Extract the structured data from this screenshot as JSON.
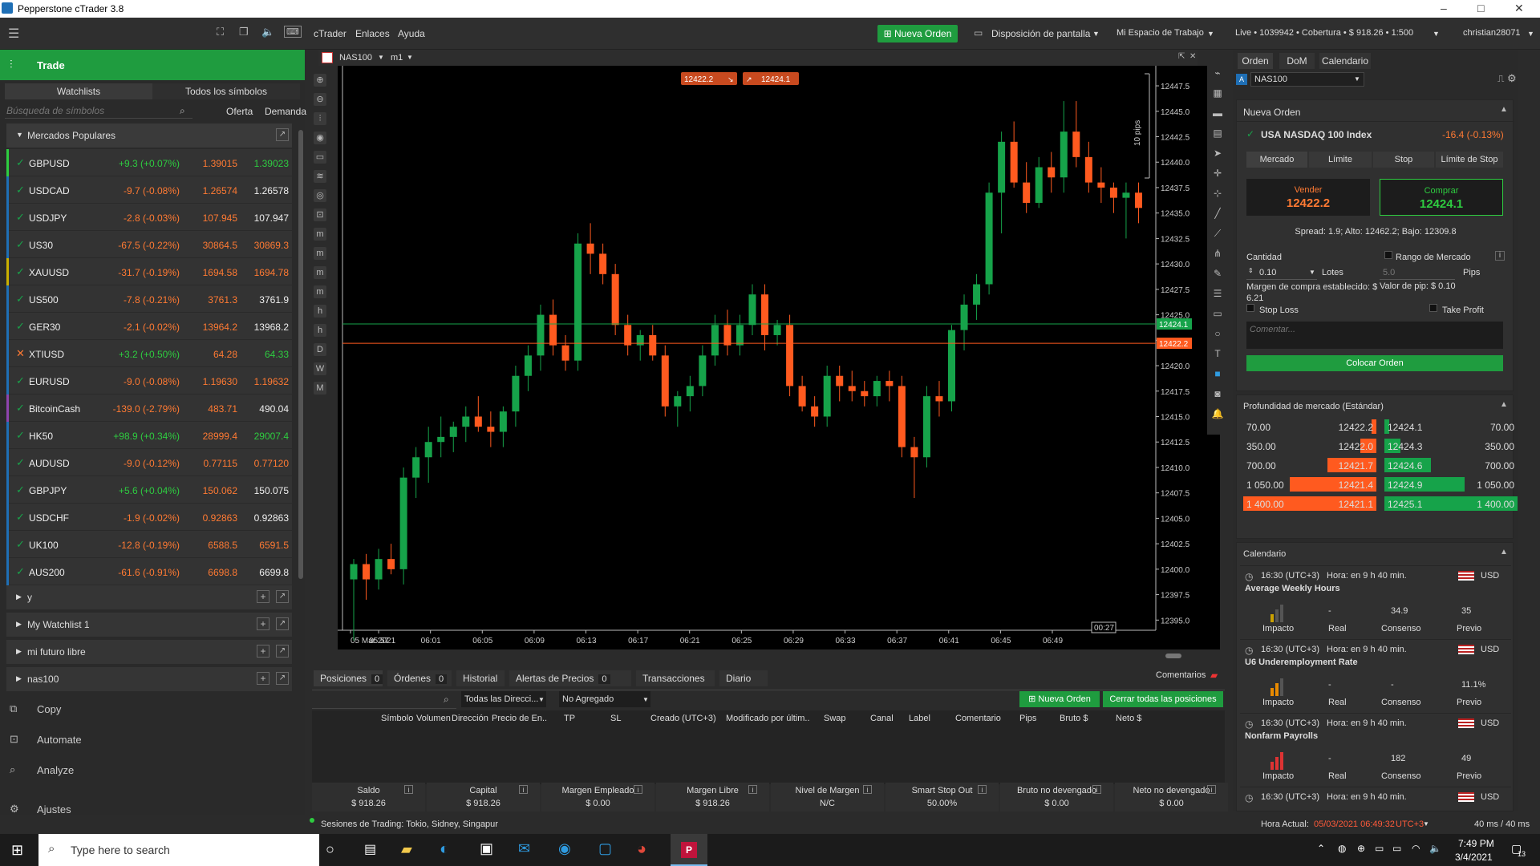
{
  "window": {
    "title": "Pepperstone cTrader 3.8",
    "min": "–",
    "max": "□",
    "close": "✕"
  },
  "menu": {
    "items": [
      "cTrader",
      "Enlaces",
      "Ayuda"
    ],
    "new_order": "Nueva Orden",
    "layout": "Disposición de pantalla",
    "workspace": "Mi Espacio de Trabajo",
    "account": "Live • 1039942 • Cobertura • $ 918.26 • 1:500",
    "user": "christian28071"
  },
  "left": {
    "header": "Trade",
    "tabs": [
      "Watchlists",
      "Todos los símbolos"
    ],
    "search_placeholder": "Búsqueda de símbolos",
    "col_bid": "Oferta",
    "col_ask": "Demanda",
    "group_title": "Mercados Populares",
    "rows": [
      {
        "sym": "GBPUSD",
        "chg": "+9.3 (+0.07%)",
        "bid": "1.39015",
        "ask": "1.39023",
        "up": true,
        "mark": "✓",
        "barcolor": "#2ecc40"
      },
      {
        "sym": "USDCAD",
        "chg": "-9.7 (-0.08%)",
        "bid": "1.26574",
        "ask": "1.26578",
        "up": false,
        "mark": "✓",
        "barcolor": "#1f6fb5"
      },
      {
        "sym": "USDJPY",
        "chg": "-2.8 (-0.03%)",
        "bid": "107.945",
        "ask": "107.947",
        "up": false,
        "mark": "✓",
        "barcolor": "#1f6fb5"
      },
      {
        "sym": "US30",
        "chg": "-67.5 (-0.22%)",
        "bid": "30864.5",
        "ask": "30869.3",
        "up": false,
        "mark": "✓",
        "barcolor": "#1f6fb5"
      },
      {
        "sym": "XAUUSD",
        "chg": "-31.7 (-0.19%)",
        "bid": "1694.58",
        "ask": "1694.78",
        "up": false,
        "mark": "✓",
        "barcolor": "#c9b000"
      },
      {
        "sym": "US500",
        "chg": "-7.8 (-0.21%)",
        "bid": "3761.3",
        "ask": "3761.9",
        "up": false,
        "mark": "✓",
        "barcolor": "#1f6fb5"
      },
      {
        "sym": "GER30",
        "chg": "-2.1 (-0.02%)",
        "bid": "13964.2",
        "ask": "13968.2",
        "up": false,
        "mark": "✓",
        "barcolor": "#1f6fb5"
      },
      {
        "sym": "XTIUSD",
        "chg": "+3.2 (+0.50%)",
        "bid": "64.28",
        "ask": "64.33",
        "up": true,
        "mark": "✕",
        "barcolor": "#1f6fb5"
      },
      {
        "sym": "EURUSD",
        "chg": "-9.0 (-0.08%)",
        "bid": "1.19630",
        "ask": "1.19632",
        "up": false,
        "mark": "✓",
        "barcolor": "#1f6fb5"
      },
      {
        "sym": "BitcoinCash",
        "chg": "-139.0 (-2.79%)",
        "bid": "483.71",
        "ask": "490.04",
        "up": false,
        "mark": "✓",
        "barcolor": "#8e44ad"
      },
      {
        "sym": "HK50",
        "chg": "+98.9 (+0.34%)",
        "bid": "28999.4",
        "ask": "29007.4",
        "up": true,
        "mark": "✓",
        "barcolor": "#1f6fb5"
      },
      {
        "sym": "AUDUSD",
        "chg": "-9.0 (-0.12%)",
        "bid": "0.77115",
        "ask": "0.77120",
        "up": false,
        "mark": "✓",
        "barcolor": "#1f6fb5"
      },
      {
        "sym": "GBPJPY",
        "chg": "+5.6 (+0.04%)",
        "bid": "150.062",
        "ask": "150.075",
        "up": true,
        "mark": "✓",
        "barcolor": "#1f6fb5"
      },
      {
        "sym": "USDCHF",
        "chg": "-1.9 (-0.02%)",
        "bid": "0.92863",
        "ask": "0.92863",
        "up": false,
        "mark": "✓",
        "barcolor": "#1f6fb5"
      },
      {
        "sym": "UK100",
        "chg": "-12.8 (-0.19%)",
        "bid": "6588.5",
        "ask": "6591.5",
        "up": false,
        "mark": "✓",
        "barcolor": "#1f6fb5"
      },
      {
        "sym": "AUS200",
        "chg": "-61.6 (-0.91%)",
        "bid": "6698.8",
        "ask": "6699.8",
        "up": false,
        "mark": "✓",
        "barcolor": "#1f6fb5"
      }
    ],
    "groups": [
      "y",
      "My Watchlist 1",
      "mi futuro libre",
      "nas100"
    ],
    "nav": [
      "Copy",
      "Automate",
      "Analyze",
      "Ajustes"
    ]
  },
  "chart": {
    "symbol": "NAS100",
    "timeframe": "m1",
    "sell_badge": "12422.2",
    "buy_badge": "12424.1",
    "pips_label": "10 pips",
    "price_ticks": [
      "12447.5",
      "12445.0",
      "12442.5",
      "12440.0",
      "12437.5",
      "12435.0",
      "12432.5",
      "12430.0",
      "12427.5",
      "12425.0",
      "12422.5",
      "12420.0",
      "12417.5",
      "12415.0",
      "12412.5",
      "12410.0",
      "12407.5",
      "12405.0",
      "12402.5",
      "12400.0",
      "12397.5",
      "12395.0"
    ],
    "time_ticks": [
      "05 Mar 2021",
      "05:57",
      "06:01",
      "06:05",
      "06:09",
      "06:13",
      "06:17",
      "06:21",
      "06:25",
      "06:29",
      "06:33",
      "06:37",
      "06:41",
      "06:45",
      "06:49"
    ],
    "ask_line": "12424.1",
    "bid_line": "12422.2",
    "countdown": "00:27"
  },
  "chart_data": {
    "type": "candlestick",
    "ylim": [
      12394,
      12449
    ],
    "hlines": [
      12424.1,
      12422.2
    ],
    "candles": [
      [
        12399,
        12401,
        12393,
        12400.5
      ],
      [
        12400.5,
        12401.5,
        12397,
        12399
      ],
      [
        12399,
        12402,
        12398,
        12401
      ],
      [
        12401,
        12402.5,
        12399.5,
        12400
      ],
      [
        12400,
        12410,
        12398.5,
        12409
      ],
      [
        12409,
        12412,
        12407,
        12411
      ],
      [
        12411,
        12414,
        12408.5,
        12412.5
      ],
      [
        12412.5,
        12415,
        12411,
        12413
      ],
      [
        12413,
        12414.5,
        12411.5,
        12414
      ],
      [
        12414,
        12416,
        12412.5,
        12415
      ],
      [
        12415,
        12417,
        12413.5,
        12414
      ],
      [
        12414,
        12415.5,
        12412,
        12413.5
      ],
      [
        12413.5,
        12416,
        12412,
        12415.5
      ],
      [
        12415.5,
        12420,
        12414,
        12419
      ],
      [
        12419,
        12422,
        12417.5,
        12421
      ],
      [
        12421,
        12426,
        12419.5,
        12425
      ],
      [
        12425,
        12426.5,
        12421,
        12422
      ],
      [
        12422,
        12423,
        12419.5,
        12420.5
      ],
      [
        12420.5,
        12433,
        12419.5,
        12432
      ],
      [
        12432,
        12434,
        12429,
        12431
      ],
      [
        12431,
        12432,
        12428,
        12429
      ],
      [
        12429,
        12430,
        12423,
        12424
      ],
      [
        12424,
        12425,
        12421,
        12422
      ],
      [
        12422,
        12423.5,
        12420.5,
        12423
      ],
      [
        12423,
        12424,
        12420.5,
        12421
      ],
      [
        12421,
        12422,
        12415,
        12416
      ],
      [
        12416,
        12417.5,
        12414,
        12417
      ],
      [
        12417,
        12419,
        12415.5,
        12418
      ],
      [
        12418,
        12422,
        12417,
        12421
      ],
      [
        12421,
        12425,
        12420,
        12424
      ],
      [
        12424,
        12425.5,
        12421,
        12422
      ],
      [
        12422,
        12425,
        12421,
        12424
      ],
      [
        12424,
        12428,
        12423,
        12427
      ],
      [
        12427,
        12428,
        12421.5,
        12423
      ],
      [
        12423,
        12424.5,
        12422,
        12424
      ],
      [
        12424,
        12425,
        12417,
        12418
      ],
      [
        12418,
        12419,
        12415.5,
        12416
      ],
      [
        12416,
        12417,
        12414,
        12415
      ],
      [
        12415,
        12420,
        12414,
        12419
      ],
      [
        12419,
        12420,
        12416.5,
        12418
      ],
      [
        12418,
        12419.5,
        12416.5,
        12417.5
      ],
      [
        12417.5,
        12418.5,
        12416,
        12417
      ],
      [
        12417,
        12419,
        12416,
        12418.5
      ],
      [
        12418.5,
        12419.5,
        12416.5,
        12418
      ],
      [
        12418,
        12419,
        12411,
        12412
      ],
      [
        12412,
        12413,
        12407,
        12411
      ],
      [
        12411,
        12418,
        12410,
        12417
      ],
      [
        12417,
        12418.5,
        12415,
        12416.5
      ],
      [
        12416.5,
        12424,
        12415.5,
        12423.5
      ],
      [
        12423.5,
        12427,
        12421.5,
        12426
      ],
      [
        12426,
        12429,
        12424.5,
        12428
      ],
      [
        12428,
        12438,
        12427,
        12437
      ],
      [
        12437,
        12443,
        12433,
        12442
      ],
      [
        12442,
        12444,
        12437.5,
        12438
      ],
      [
        12438,
        12440,
        12435,
        12436
      ],
      [
        12436,
        12440.5,
        12435.5,
        12439.5
      ],
      [
        12439.5,
        12441,
        12437,
        12438.5
      ],
      [
        12438.5,
        12446,
        12437,
        12443
      ],
      [
        12443,
        12446,
        12439.5,
        12440.5
      ],
      [
        12440.5,
        12442,
        12437,
        12438
      ],
      [
        12438,
        12439.5,
        12436,
        12437.5
      ],
      [
        12437.5,
        12438,
        12435,
        12436.5
      ],
      [
        12436.5,
        12438,
        12432.5,
        12437
      ],
      [
        12437,
        12438,
        12434,
        12435.5
      ]
    ]
  },
  "order": {
    "tabs": [
      "Orden",
      "DoM",
      "Calendario"
    ],
    "symbol": "NAS100",
    "title": "Nueva Orden",
    "instrument": "USA NASDAQ 100 Index",
    "change": "-16.4 (-0.13%)",
    "types": [
      "Mercado",
      "Límite",
      "Stop",
      "Límite de Stop"
    ],
    "sell_label": "Vender",
    "sell_price": "12422.2",
    "buy_label": "Comprar",
    "buy_price": "12424.1",
    "spread": "Spread: 1.9; Alto: 12462.2; Bajo: 12309.8",
    "qty_label": "Cantidad",
    "range_label": "Rango de Mercado",
    "qty": "0.10",
    "lots": "Lotes",
    "pips_val": "5.0",
    "pips": "Pips",
    "margin": "Margen de compra establecido: $ 6.21",
    "pip_value": "Valor de pip: $ 0.10",
    "stop_loss": "Stop Loss",
    "take_profit": "Take Profit",
    "comment_placeholder": "Comentar...",
    "place": "Colocar Orden"
  },
  "depth": {
    "title": "Profundidad de mercado (Estándar)",
    "bids": [
      [
        "70.00",
        "12422.2",
        0.02
      ],
      [
        "350.00",
        "12422.0",
        0.12
      ],
      [
        "700.00",
        "12421.7",
        0.37
      ],
      [
        "1 050.00",
        "12421.4",
        0.65
      ],
      [
        "1 400.00",
        "12421.1",
        1.0
      ]
    ],
    "asks": [
      [
        "12424.1",
        "70.00",
        0.02
      ],
      [
        "12424.3",
        "350.00",
        0.12
      ],
      [
        "12424.6",
        "700.00",
        0.35
      ],
      [
        "12424.9",
        "1 050.00",
        0.6
      ],
      [
        "12425.1",
        "1 400.00",
        1.0
      ]
    ]
  },
  "calendar": {
    "title": "Calendario",
    "events": [
      {
        "time": "16:30 (UTC+3)",
        "hora": "Hora:",
        "left": "en 9 h 40 min.",
        "cur": "USD",
        "name": "Average Weekly Hours",
        "real": "-",
        "cons": "34.9",
        "prev": "35",
        "impact": 1
      },
      {
        "time": "16:30 (UTC+3)",
        "hora": "Hora:",
        "left": "en 9 h 40 min.",
        "cur": "USD",
        "name": "U6 Underemployment Rate",
        "real": "-",
        "cons": "-",
        "prev": "11.1%",
        "impact": 2
      },
      {
        "time": "16:30 (UTC+3)",
        "hora": "Hora:",
        "left": "en 9 h 40 min.",
        "cur": "USD",
        "name": "Nonfarm Payrolls",
        "real": "-",
        "cons": "182",
        "prev": "49",
        "impact": 3
      },
      {
        "time": "16:30 (UTC+3)",
        "hora": "Hora:",
        "left": "en 9 h 40 min.",
        "cur": "USD",
        "name": "",
        "real": "",
        "cons": "",
        "prev": "",
        "impact": 0
      }
    ],
    "labels": [
      "Impacto",
      "Real",
      "Consenso",
      "Previo"
    ]
  },
  "positions": {
    "tabs": [
      {
        "label": "Posiciones",
        "count": "0"
      },
      {
        "label": "Órdenes",
        "count": "0"
      },
      {
        "label": "Historial"
      },
      {
        "label": "Alertas de Precios",
        "count": "0"
      },
      {
        "label": "Transacciones"
      },
      {
        "label": "Diario"
      }
    ],
    "comments": "Comentarios",
    "filter1": "Todas las Direcci...",
    "filter2": "No Agregado",
    "new_order": "Nueva Orden",
    "close_all": "Cerrar todas las posiciones",
    "columns": [
      "Símbolo",
      "Volumen",
      "Dirección",
      "Precio de En..",
      "TP",
      "SL",
      "Creado (UTC+3)",
      "Modificado por últim..",
      "Swap",
      "Canal",
      "Label",
      "Comentario",
      "Pips",
      "Bruto $",
      "Neto $"
    ],
    "summary": [
      [
        "Saldo",
        "$ 918.26"
      ],
      [
        "Capital",
        "$ 918.26"
      ],
      [
        "Margen Empleado",
        "$ 0.00"
      ],
      [
        "Margen Libre",
        "$ 918.26"
      ],
      [
        "Nivel de Margen",
        "N/C"
      ],
      [
        "Smart Stop Out",
        "50.00%"
      ],
      [
        "Bruto no devengado",
        "$ 0.00"
      ],
      [
        "Neto no devengado",
        "$ 0.00"
      ]
    ]
  },
  "status": {
    "sessions": "Sesiones de Trading: Tokio, Sidney, Singapur",
    "time_label": "Hora Actual:",
    "time_value": "05/03/2021 06:49:32",
    "tz": "UTC+3",
    "latency": "40 ms / 40 ms"
  },
  "taskbar": {
    "search": "Type here to search",
    "clock": "7:49 PM",
    "date": "3/4/2021",
    "notif": "13"
  }
}
